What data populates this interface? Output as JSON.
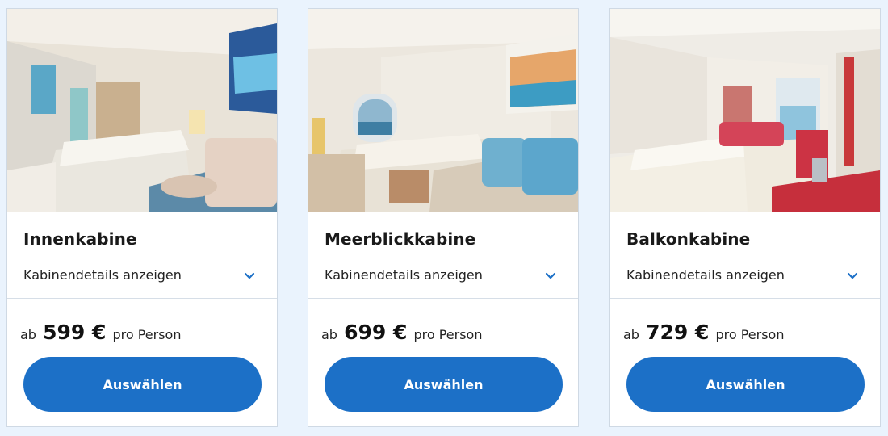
{
  "cabins": [
    {
      "name": "Innenkabine",
      "details_label": "Kabinendetails anzeigen",
      "price_prefix": "ab",
      "price": "599 €",
      "price_suffix": "pro Person",
      "button_label": "Auswählen"
    },
    {
      "name": "Meerblickkabine",
      "details_label": "Kabinendetails anzeigen",
      "price_prefix": "ab",
      "price": "699 €",
      "price_suffix": "pro Person",
      "button_label": "Auswählen"
    },
    {
      "name": "Balkonkabine",
      "details_label": "Kabinendetails anzeigen",
      "price_prefix": "ab",
      "price": "729 €",
      "price_suffix": "pro Person",
      "button_label": "Auswählen"
    }
  ],
  "colors": {
    "page_background": "#eaf3fd",
    "button": "#1c70c7",
    "chevron": "#1c70c7"
  },
  "icons": {
    "expand": "chevron-down-icon"
  }
}
